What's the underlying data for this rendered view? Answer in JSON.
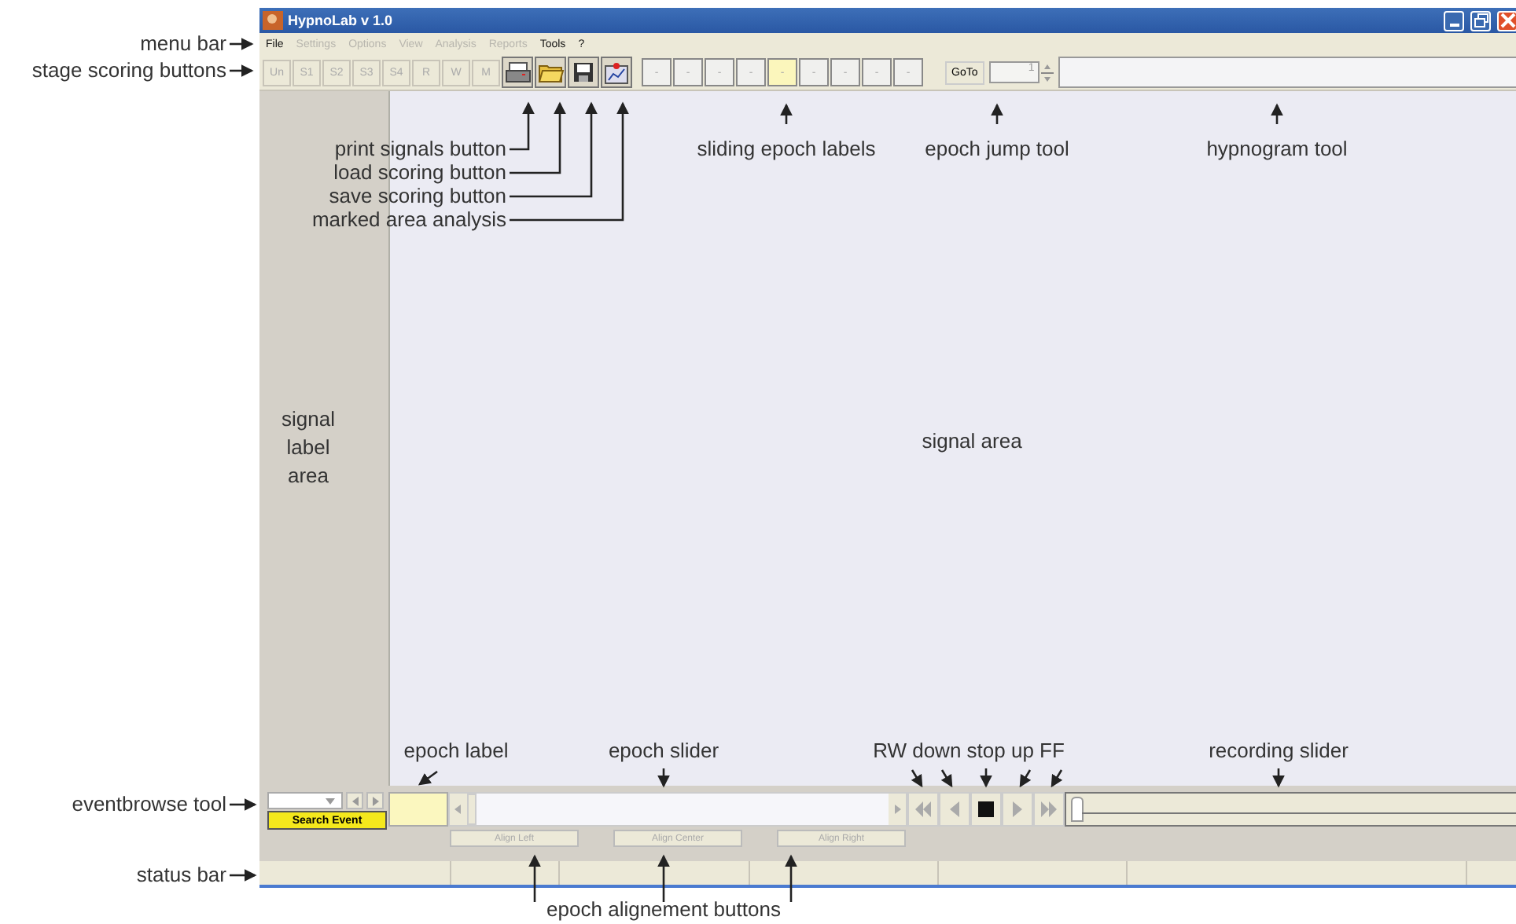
{
  "window": {
    "title": "HypnoLab v 1.0"
  },
  "menu": [
    {
      "label": "File",
      "disabled": false
    },
    {
      "label": "Settings",
      "disabled": true
    },
    {
      "label": "Options",
      "disabled": true
    },
    {
      "label": "View",
      "disabled": true
    },
    {
      "label": "Analysis",
      "disabled": true
    },
    {
      "label": "Reports",
      "disabled": true
    },
    {
      "label": "Tools",
      "disabled": false
    },
    {
      "label": "?",
      "disabled": false
    }
  ],
  "stage_buttons": [
    "Un",
    "S1",
    "S2",
    "S3",
    "S4",
    "R",
    "W",
    "M"
  ],
  "epoch_labels": [
    {
      "label": "-",
      "selected": false
    },
    {
      "label": "-",
      "selected": false
    },
    {
      "label": "-",
      "selected": false
    },
    {
      "label": "-",
      "selected": false
    },
    {
      "label": "-",
      "selected": true
    },
    {
      "label": "-",
      "selected": false
    },
    {
      "label": "-",
      "selected": false
    },
    {
      "label": "-",
      "selected": false
    },
    {
      "label": "-",
      "selected": false
    }
  ],
  "goto": {
    "button": "GoTo",
    "value": "1"
  },
  "event_browse": {
    "button": "Search Event"
  },
  "epoch_slider": {
    "level": 0
  },
  "recording_slider": {
    "level": 0
  },
  "align_buttons": [
    "Align Left",
    "Align Center",
    "Align Right"
  ],
  "annotations": {
    "menu_bar": "menu bar",
    "stage_scoring": "stage scoring buttons",
    "print_signals": "print signals button",
    "load_scoring": "load scoring button",
    "save_scoring": "save scoring button",
    "marked_area": "marked area analysis",
    "sliding_epoch": "sliding epoch labels",
    "epoch_jump": "epoch jump tool",
    "hypnogram": "hypnogram tool",
    "signal_label_area": "signal label area",
    "signal_area": "signal area",
    "epoch_label": "epoch label",
    "epoch_slider": "epoch slider",
    "media": "RW down stop up FF",
    "recording_slider": "recording slider",
    "eventbrowse": "eventbrowse tool",
    "status_bar": "status bar",
    "alignment": "epoch alignement buttons"
  }
}
